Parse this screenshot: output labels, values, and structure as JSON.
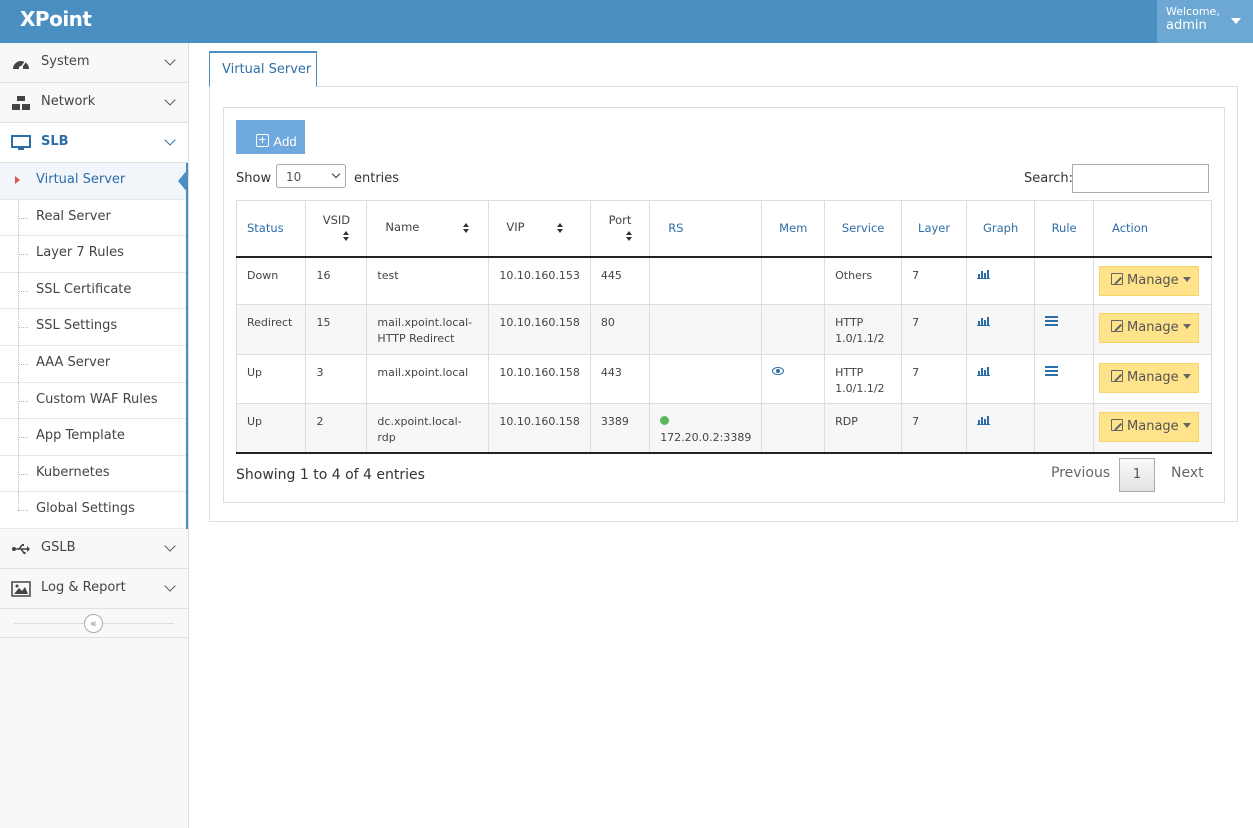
{
  "app": {
    "title": "XPoint"
  },
  "user": {
    "welcome": "Welcome,",
    "name": "admin"
  },
  "sidebar": {
    "groups": [
      {
        "label": "System",
        "icon": "dashboard-icon"
      },
      {
        "label": "Network",
        "icon": "network-icon"
      },
      {
        "label": "SLB",
        "icon": "monitor-icon"
      },
      {
        "label": "GSLB",
        "icon": "usb-icon"
      },
      {
        "label": "Log & Report",
        "icon": "image-icon"
      }
    ],
    "slb_items": [
      {
        "label": "Virtual Server"
      },
      {
        "label": "Real Server"
      },
      {
        "label": "Layer 7 Rules"
      },
      {
        "label": "SSL Certificate"
      },
      {
        "label": "SSL Settings"
      },
      {
        "label": "AAA Server"
      },
      {
        "label": "Custom WAF Rules"
      },
      {
        "label": "App Template"
      },
      {
        "label": "Kubernetes"
      },
      {
        "label": "Global Settings"
      }
    ],
    "collapse_glyph": "«"
  },
  "tabs": [
    {
      "label": "Virtual Server"
    }
  ],
  "toolbar": {
    "add_label": "Add"
  },
  "length": {
    "show": "Show",
    "value": "10",
    "entries": "entries"
  },
  "search": {
    "label": "Search:",
    "value": ""
  },
  "table": {
    "headers": [
      "Status",
      "VSID",
      "Name",
      "VIP",
      "Port",
      "RS",
      "Mem",
      "Service",
      "Layer",
      "Graph",
      "Rule",
      "Action"
    ],
    "rows": [
      {
        "status": "Down",
        "vsid": "16",
        "name": "test",
        "vip": "10.10.160.153",
        "port": "445",
        "rs": "",
        "mem": false,
        "service": "Others",
        "layer": "7",
        "rule": false,
        "action": "Manage"
      },
      {
        "status": "Redirect",
        "vsid": "15",
        "name": "mail.xpoint.local-HTTP Redirect",
        "vip": "10.10.160.158",
        "port": "80",
        "rs": "",
        "mem": false,
        "service": "HTTP 1.0/1.1/2",
        "layer": "7",
        "rule": true,
        "action": "Manage"
      },
      {
        "status": "Up",
        "vsid": "3",
        "name": "mail.xpoint.local",
        "vip": "10.10.160.158",
        "port": "443",
        "rs": "",
        "mem": true,
        "service": "HTTP 1.0/1.1/2",
        "layer": "7",
        "rule": true,
        "action": "Manage"
      },
      {
        "status": "Up",
        "vsid": "2",
        "name": "dc.xpoint.local-rdp",
        "vip": "10.10.160.158",
        "port": "3389",
        "rs": "172.20.0.2:3389",
        "mem": false,
        "service": "RDP",
        "layer": "7",
        "rule": false,
        "action": "Manage"
      }
    ]
  },
  "footer": {
    "info": "Showing 1 to 4 of 4 entries",
    "prev": "Previous",
    "page": "1",
    "next": "Next"
  },
  "colors": {
    "header": "#4a8fc2",
    "accent": "#2c6ea8",
    "manage": "#ffe38a",
    "add": "#6fa8dc",
    "rs_up": "#5cb85c"
  }
}
